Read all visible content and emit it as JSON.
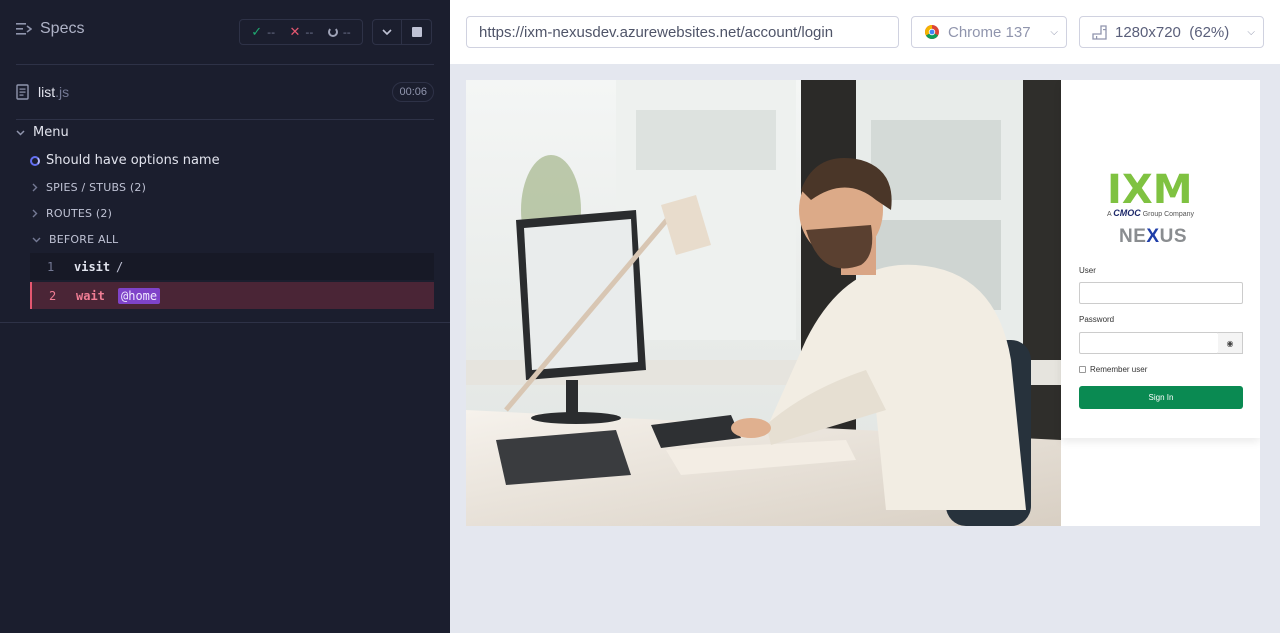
{
  "reporter": {
    "specs_label": "Specs",
    "stats": {
      "passed": "--",
      "failed": "--",
      "pending": "--"
    },
    "file": {
      "base": "list",
      "ext": ".js",
      "duration": "00:06"
    },
    "suite_title": "Menu",
    "test_title": "Should have options name",
    "sections": [
      "SPIES / STUBS (2)",
      "ROUTES (2)",
      "BEFORE ALL"
    ],
    "commands": [
      {
        "num": "1",
        "name": "visit",
        "message": "/"
      },
      {
        "num": "2",
        "name": "wait",
        "alias": "@home"
      }
    ]
  },
  "topbar": {
    "url": "https://ixm-nexusdev.azurewebsites.net/account/login",
    "browser": "Chrome 137",
    "viewport": "1280x720  (62%)"
  },
  "app": {
    "logo_main": "IXM",
    "logo_sub_prefix": "A",
    "logo_sub_brand": "CMOC",
    "logo_sub_suffix": "Group Company",
    "logo_product_a": "NE",
    "logo_product_x": "X",
    "logo_product_b": "US",
    "user_label": "User",
    "password_label": "Password",
    "remember_label": "Remember user",
    "signin_label": "Sign In"
  },
  "colors": {
    "reporter_bg": "#1b1e2e",
    "pass": "#1fa971",
    "fail": "#e45770",
    "alias": "#7f43c9",
    "signin": "#0a8a52",
    "logo_green": "#7fc241",
    "logo_blue": "#1f3ea8"
  }
}
